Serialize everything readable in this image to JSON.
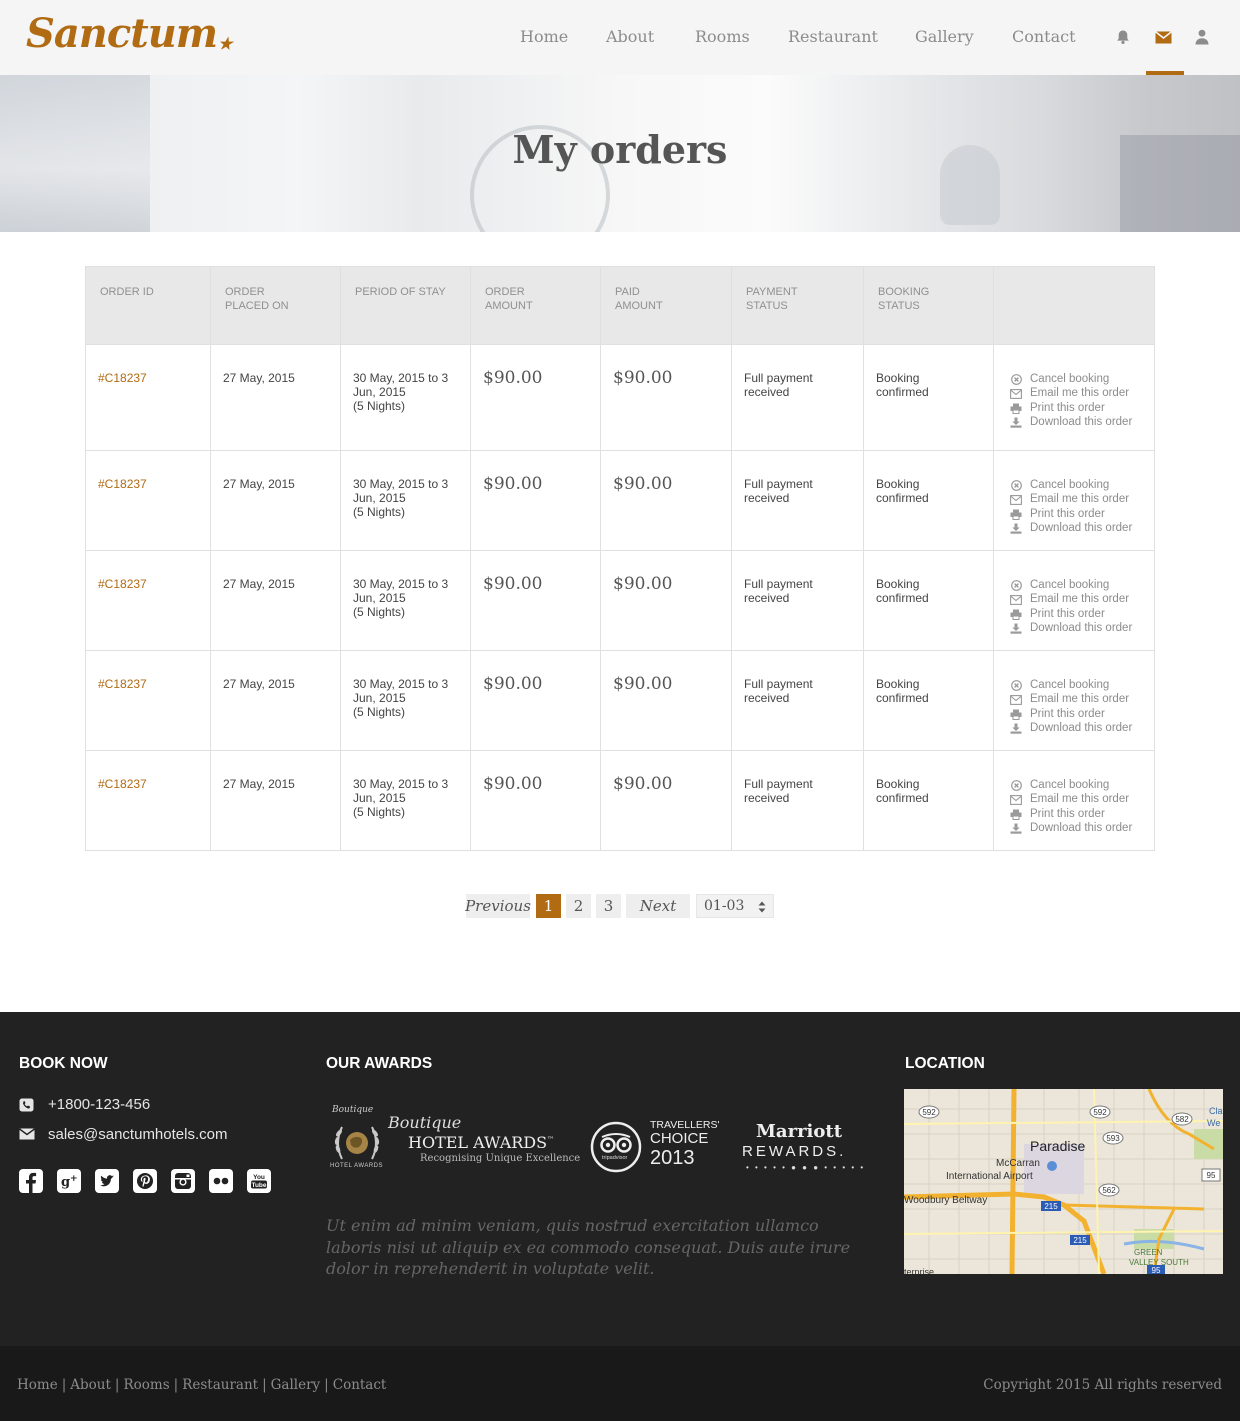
{
  "brand": {
    "name": "Sanctum",
    "star": "★",
    "accent_color": "#b06b13"
  },
  "nav": {
    "items": [
      "Home",
      "About",
      "Rooms",
      "Restaurant",
      "Gallery",
      "Contact"
    ],
    "icons": [
      "bell-icon",
      "envelope-icon",
      "user-icon"
    ],
    "active_icon": "envelope-icon"
  },
  "hero": {
    "title": "My orders"
  },
  "orders_table": {
    "headers": [
      "ORDER ID",
      "ORDER PLACED ON",
      "PERIOD OF STAY",
      "ORDER AMOUNT",
      "PAID AMOUNT",
      "PAYMENT STATUS",
      "BOOKING STATUS",
      ""
    ],
    "header_lines": [
      [
        "ORDER ID"
      ],
      [
        "ORDER",
        "PLACED ON"
      ],
      [
        "PERIOD OF STAY"
      ],
      [
        "ORDER",
        "AMOUNT"
      ],
      [
        "PAID",
        "AMOUNT"
      ],
      [
        "PAYMENT",
        "STATUS"
      ],
      [
        "BOOKING",
        "STATUS"
      ],
      []
    ],
    "rows": [
      {
        "order_id": "#C18237",
        "placed_on": "27 May, 2015",
        "period_line1": "30 May, 2015 to 3",
        "period_line2": "Jun, 2015",
        "period_line3": "(5 Nights)",
        "order_amount": "$90.00",
        "paid_amount": "$90.00",
        "payment_line1": "Full payment",
        "payment_line2": "received",
        "booking_line1": "Booking",
        "booking_line2": "confirmed"
      },
      {
        "order_id": "#C18237",
        "placed_on": "27 May, 2015",
        "period_line1": "30 May, 2015 to 3",
        "period_line2": "Jun, 2015",
        "period_line3": "(5 Nights)",
        "order_amount": "$90.00",
        "paid_amount": "$90.00",
        "payment_line1": "Full payment",
        "payment_line2": "received",
        "booking_line1": "Booking",
        "booking_line2": "confirmed"
      },
      {
        "order_id": "#C18237",
        "placed_on": "27 May, 2015",
        "period_line1": "30 May, 2015 to 3",
        "period_line2": "Jun, 2015",
        "period_line3": "(5 Nights)",
        "order_amount": "$90.00",
        "paid_amount": "$90.00",
        "payment_line1": "Full payment",
        "payment_line2": "received",
        "booking_line1": "Booking",
        "booking_line2": "confirmed"
      },
      {
        "order_id": "#C18237",
        "placed_on": "27 May, 2015",
        "period_line1": "30 May, 2015 to 3",
        "period_line2": "Jun, 2015",
        "period_line3": "(5 Nights)",
        "order_amount": "$90.00",
        "paid_amount": "$90.00",
        "payment_line1": "Full payment",
        "payment_line2": "received",
        "booking_line1": "Booking",
        "booking_line2": "confirmed"
      },
      {
        "order_id": "#C18237",
        "placed_on": "27 May, 2015",
        "period_line1": "30 May, 2015 to 3",
        "period_line2": "Jun, 2015",
        "period_line3": "(5 Nights)",
        "order_amount": "$90.00",
        "paid_amount": "$90.00",
        "payment_line1": "Full payment",
        "payment_line2": "received",
        "booking_line1": "Booking",
        "booking_line2": "confirmed"
      }
    ],
    "actions": [
      {
        "label": "Cancel booking",
        "icon": "cancel-icon"
      },
      {
        "label": "Email me this order",
        "icon": "envelope-icon"
      },
      {
        "label": "Print this order",
        "icon": "print-icon"
      },
      {
        "label": "Download this order",
        "icon": "download-icon"
      }
    ]
  },
  "pagination": {
    "previous": "Previous",
    "pages": [
      "1",
      "2",
      "3"
    ],
    "current_page": "1",
    "next": "Next",
    "range_select": "01-03"
  },
  "footer": {
    "book_now": {
      "heading": "BOOK NOW",
      "phone": "+1800-123-456",
      "email": "sales@sanctumhotels.com"
    },
    "socials": [
      "facebook-icon",
      "google-plus-icon",
      "twitter-icon",
      "pinterest-icon",
      "instagram-icon",
      "flickr-icon",
      "youtube-icon"
    ],
    "social_glyphs": [
      "f",
      "g+",
      "t",
      "p",
      "◎",
      "●●",
      "You Tube"
    ],
    "awards": {
      "heading": "OUR AWARDS",
      "badge1": {
        "top": "Boutique",
        "bottom": "HOTEL AWARDS"
      },
      "badge2": {
        "script": "Boutique",
        "name": "HOTEL AWARDS",
        "tm": "™",
        "tagline": "Recognising Unique Excellence"
      },
      "badge3": {
        "line1": "TRAVELLERS'",
        "line2": "CHOICE",
        "line3": "2013",
        "brand": "tripadvisor"
      },
      "badge4": {
        "line1": "Marriott",
        "line2": "REWARDS."
      },
      "quote": "Ut enim ad minim veniam, quis nostrud exercitation ullamco laboris nisi ut aliquip ex ea commodo consequat. Duis aute irure dolor in reprehenderit in voluptate velit."
    },
    "location": {
      "heading": "LOCATION",
      "map_labels": [
        "Paradise",
        "McCarran",
        "International Airport",
        "Woodbury Beltway",
        "GREEN",
        "VALLEY SOUTH",
        "Cla",
        "We",
        "terprise"
      ],
      "road_shields": [
        "592",
        "592",
        "593",
        "582",
        "562",
        "215",
        "215",
        "95",
        "95"
      ]
    },
    "bottom_links": [
      "Home",
      "About",
      "Rooms",
      "Restaurant",
      "Gallery",
      "Contact"
    ],
    "copyright": "Copyright 2015 All rights reserved"
  }
}
